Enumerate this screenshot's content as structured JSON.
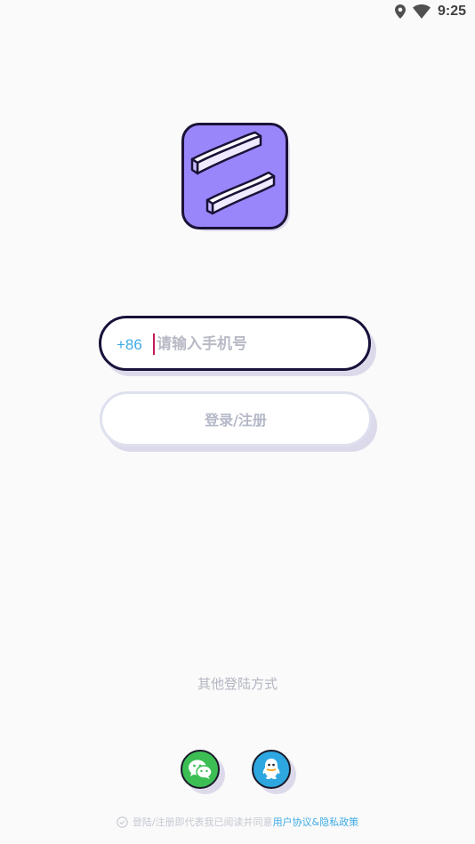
{
  "status_bar": {
    "time": "9:25",
    "icons": [
      "location-icon",
      "wifi-icon"
    ]
  },
  "logo": {
    "icon": "app-logo-icon",
    "colors": {
      "background": "#9a86fb",
      "border": "#1b1238"
    }
  },
  "phone_field": {
    "country_code": "+86",
    "placeholder": "请输入手机号",
    "value": ""
  },
  "login_button": {
    "label": "登录/注册"
  },
  "other_login": {
    "label": "其他登陆方式",
    "options": [
      {
        "icon": "wechat-icon",
        "color": "#3dbe55"
      },
      {
        "icon": "qq-icon",
        "color": "#2ea7e0"
      }
    ]
  },
  "agreement": {
    "checkbox_icon": "check-circle-icon",
    "text": "登陆/注册即代表我已阅读并同意",
    "link": "用户协议&隐私政策"
  },
  "colors": {
    "accent": "#3dabe6",
    "dark_border": "#17123a",
    "background": "#fafafa"
  }
}
